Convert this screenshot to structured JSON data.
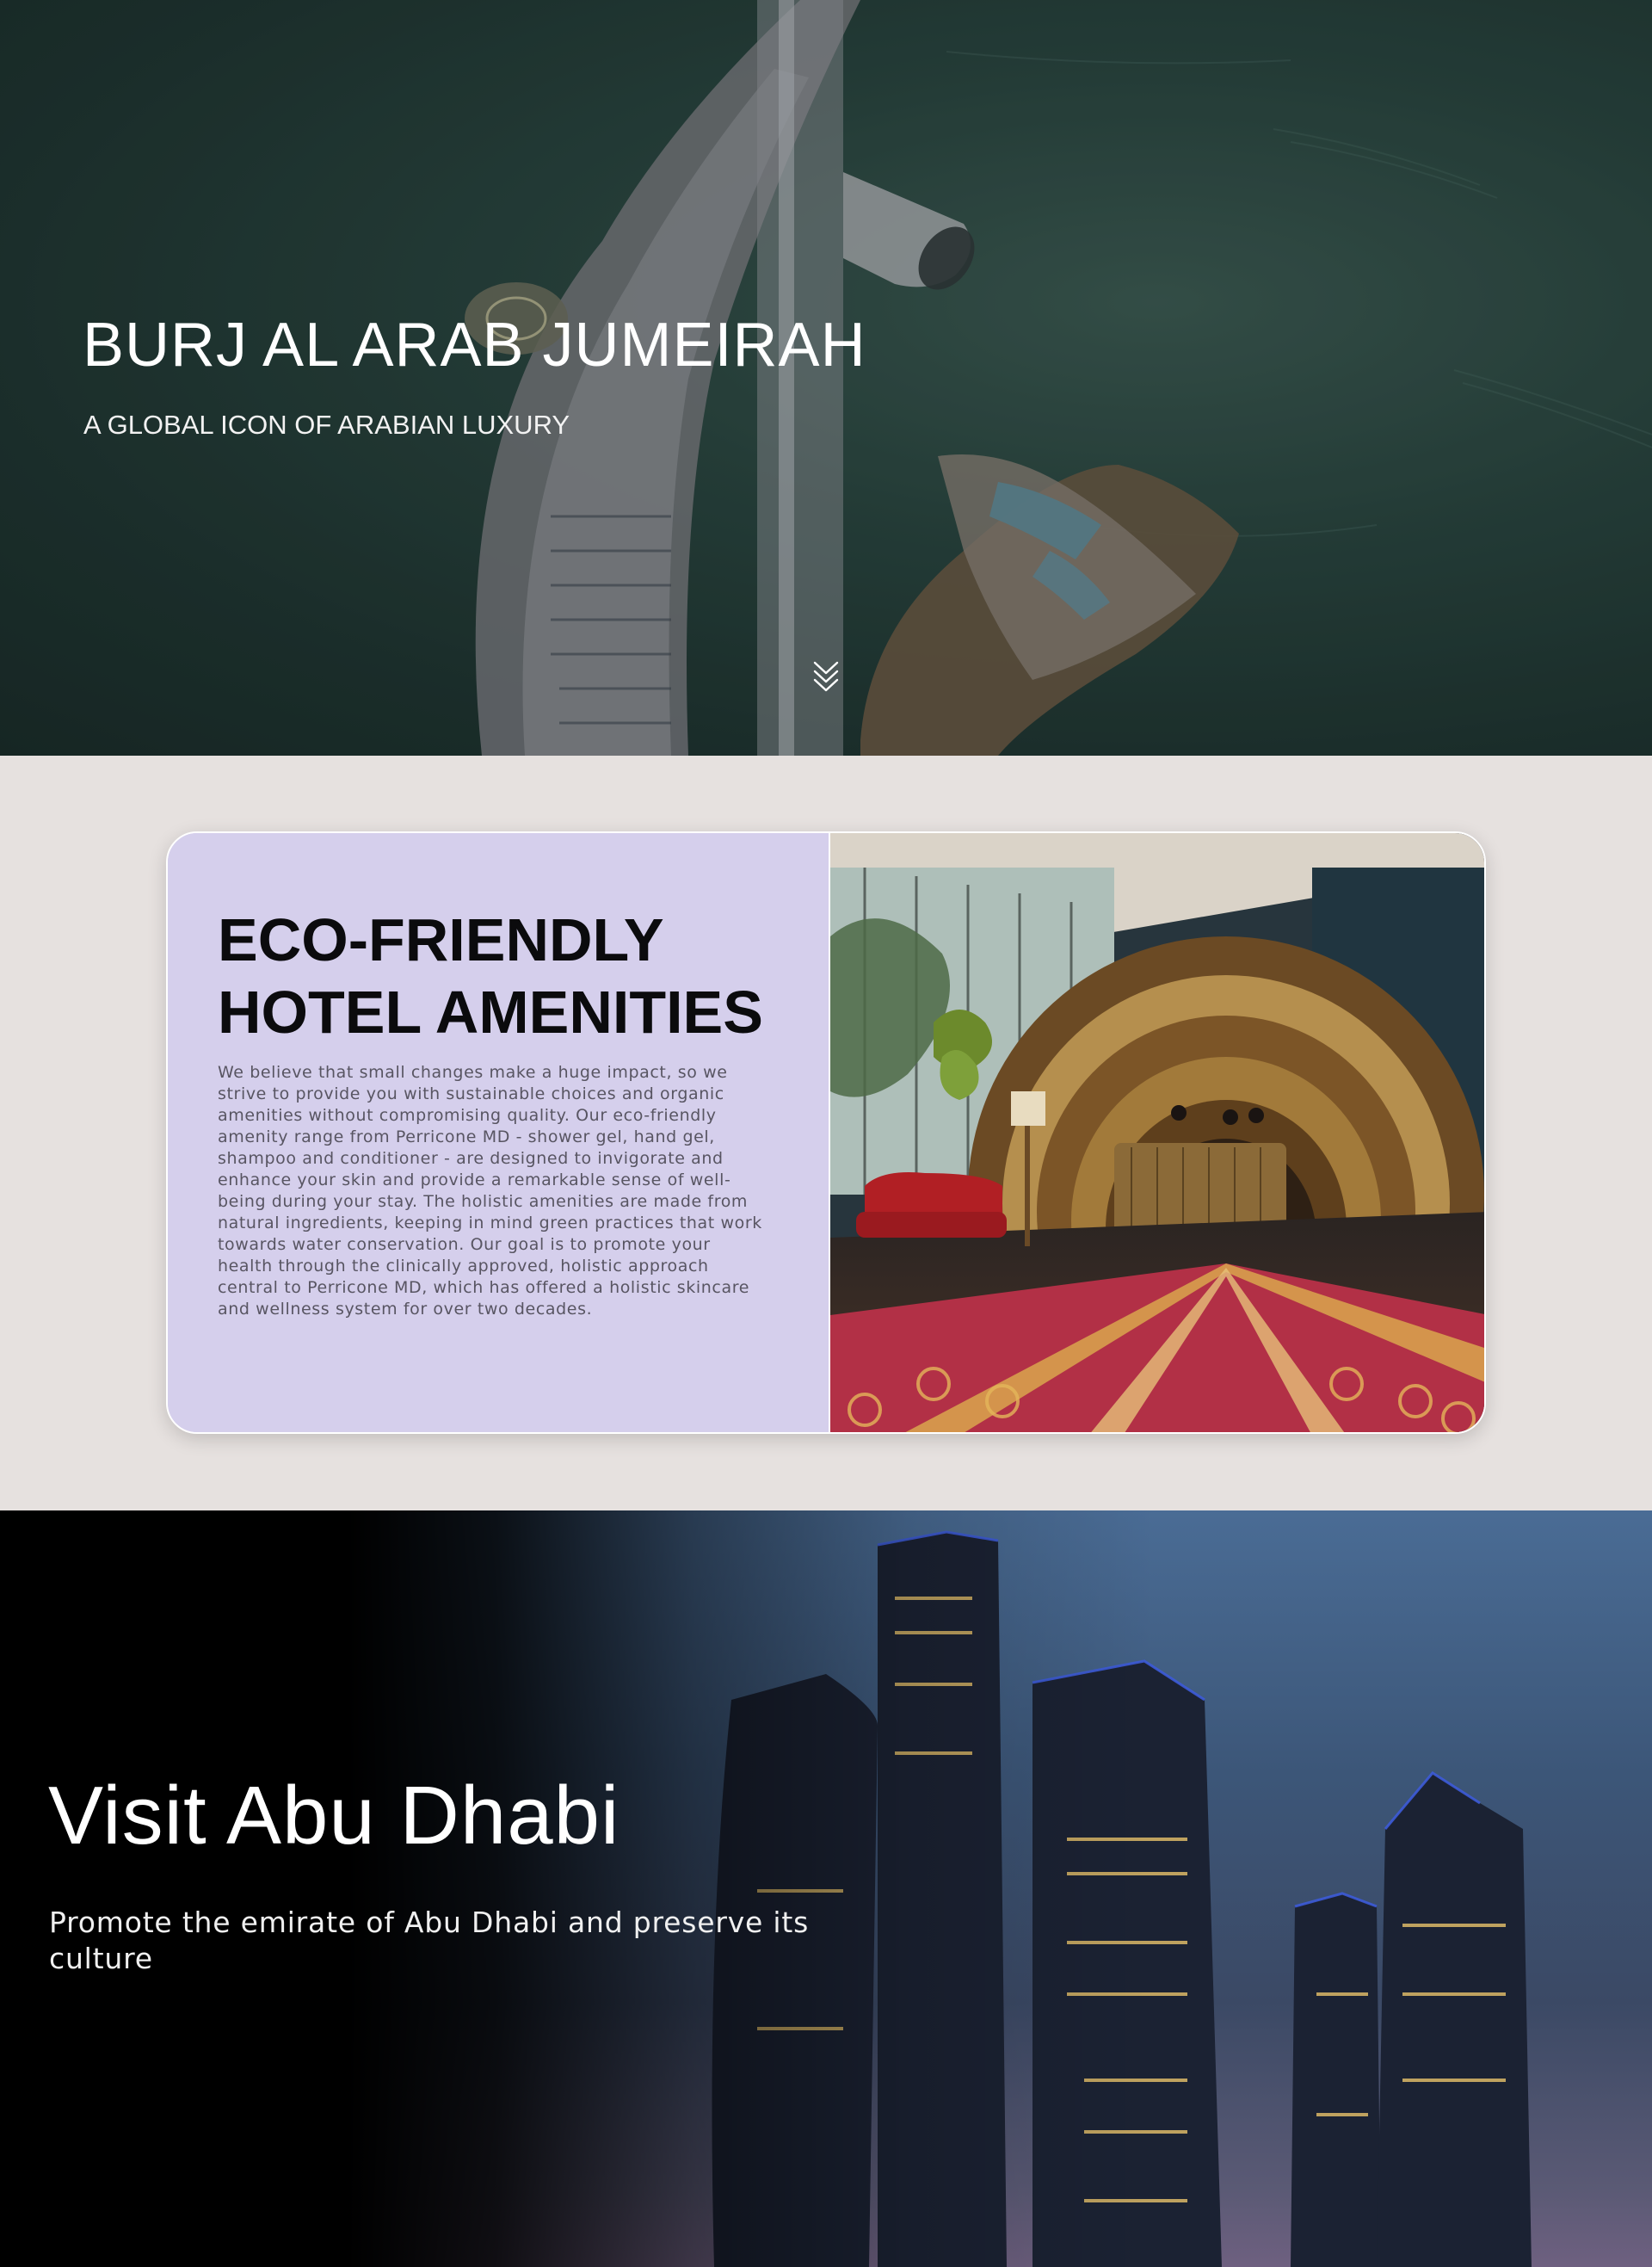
{
  "hero": {
    "title": "BURJ AL ARAB JUMEIRAH",
    "subtitle": "A GLOBAL ICON OF ARABIAN LUXURY",
    "scroll_icon": "double-chevron-down-icon"
  },
  "amenities": {
    "title_line1": "ECO-FRIENDLY",
    "title_line2": "HOTEL AMENITIES",
    "body": "We believe that small changes make a huge impact, so we strive to provide you with sustainable choices and organic amenities without compromising quality. Our eco-friendly amenity range from Perricone MD - shower gel, hand gel, shampoo and conditioner - are designed to invigorate and enhance your skin and provide a remarkable sense of well-being during your stay. The holistic amenities are made from natural ingredients, keeping in mind green practices that work towards water conservation. Our goal is to promote your health through the clinically approved, holistic approach central to Perricone MD, which has offered a holistic skincare and wellness system for over two decades.",
    "card_color": "#d5cfec"
  },
  "abu_dhabi": {
    "title": "Visit Abu Dhabi",
    "subtitle": "Promote the emirate of Abu Dhabi and preserve its culture"
  }
}
